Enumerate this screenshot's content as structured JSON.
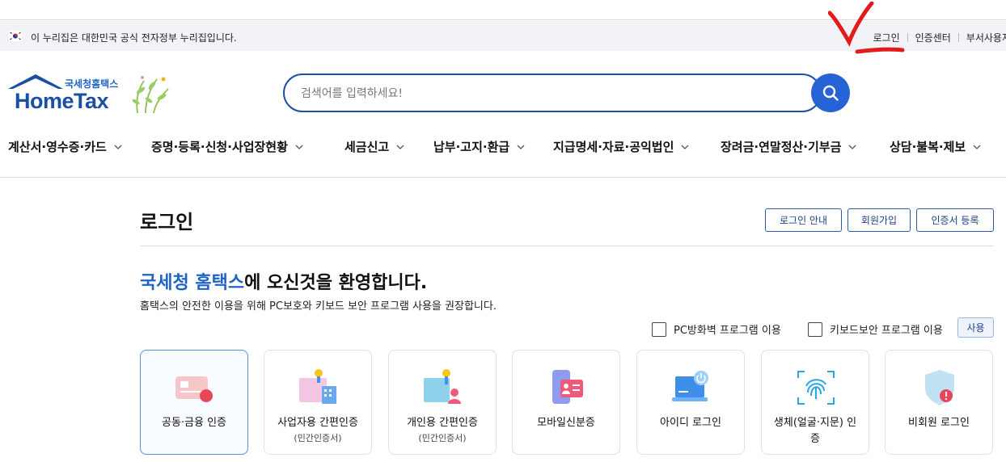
{
  "gov_banner": {
    "text": "이 누리집은 대한민국 공식 전자정부 누리집입니다.",
    "links": [
      "로그인",
      "인증센터",
      "부서사용자"
    ]
  },
  "logo": {
    "sub": "국세청홈택스",
    "main": "HomeTax"
  },
  "search": {
    "placeholder": "검색어를 입력하세요!"
  },
  "gnb": [
    "계산서·영수증·카드",
    "증명·등록·신청·사업장현황",
    "세금신고",
    "납부·고지·환급",
    "지급명세·자료·공익법인",
    "장려금·연말정산·기부금",
    "상담·불복·제보"
  ],
  "page": {
    "title": "로그인",
    "buttons": [
      "로그인 안내",
      "회원가입",
      "인증서 등록"
    ],
    "welcome_brand": "국세청 홈택스",
    "welcome_rest": "에 오신것을 환영합니다.",
    "notice": "홈택스의 안전한 이용을 위해 PC보호와 키보드 보안 프로그램 사용을 권장합니다.",
    "checks": [
      "PC방화벽 프로그램 이용",
      "키보드보안 프로그램 이용"
    ],
    "use_button": "사용"
  },
  "login_methods": [
    {
      "label": "공동·금융 인증",
      "sub": "",
      "icon": "certificate-card-icon"
    },
    {
      "label": "사업자용 간편인증",
      "sub": "(민간인증서)",
      "icon": "business-simple-auth-icon"
    },
    {
      "label": "개인용 간편인증",
      "sub": "(민간인증서)",
      "icon": "personal-simple-auth-icon"
    },
    {
      "label": "모바일신분증",
      "sub": "",
      "icon": "mobile-id-icon"
    },
    {
      "label": "아이디 로그인",
      "sub": "",
      "icon": "laptop-power-icon"
    },
    {
      "label": "생체(얼굴·지문) 인증",
      "sub": "",
      "icon": "fingerprint-icon"
    },
    {
      "label": "비회원 로그인",
      "sub": "",
      "icon": "shield-icon"
    }
  ],
  "colors": {
    "brand_blue": "#1d64c6",
    "search_button": "#2563d6",
    "annotation_red": "#e31b1b"
  }
}
